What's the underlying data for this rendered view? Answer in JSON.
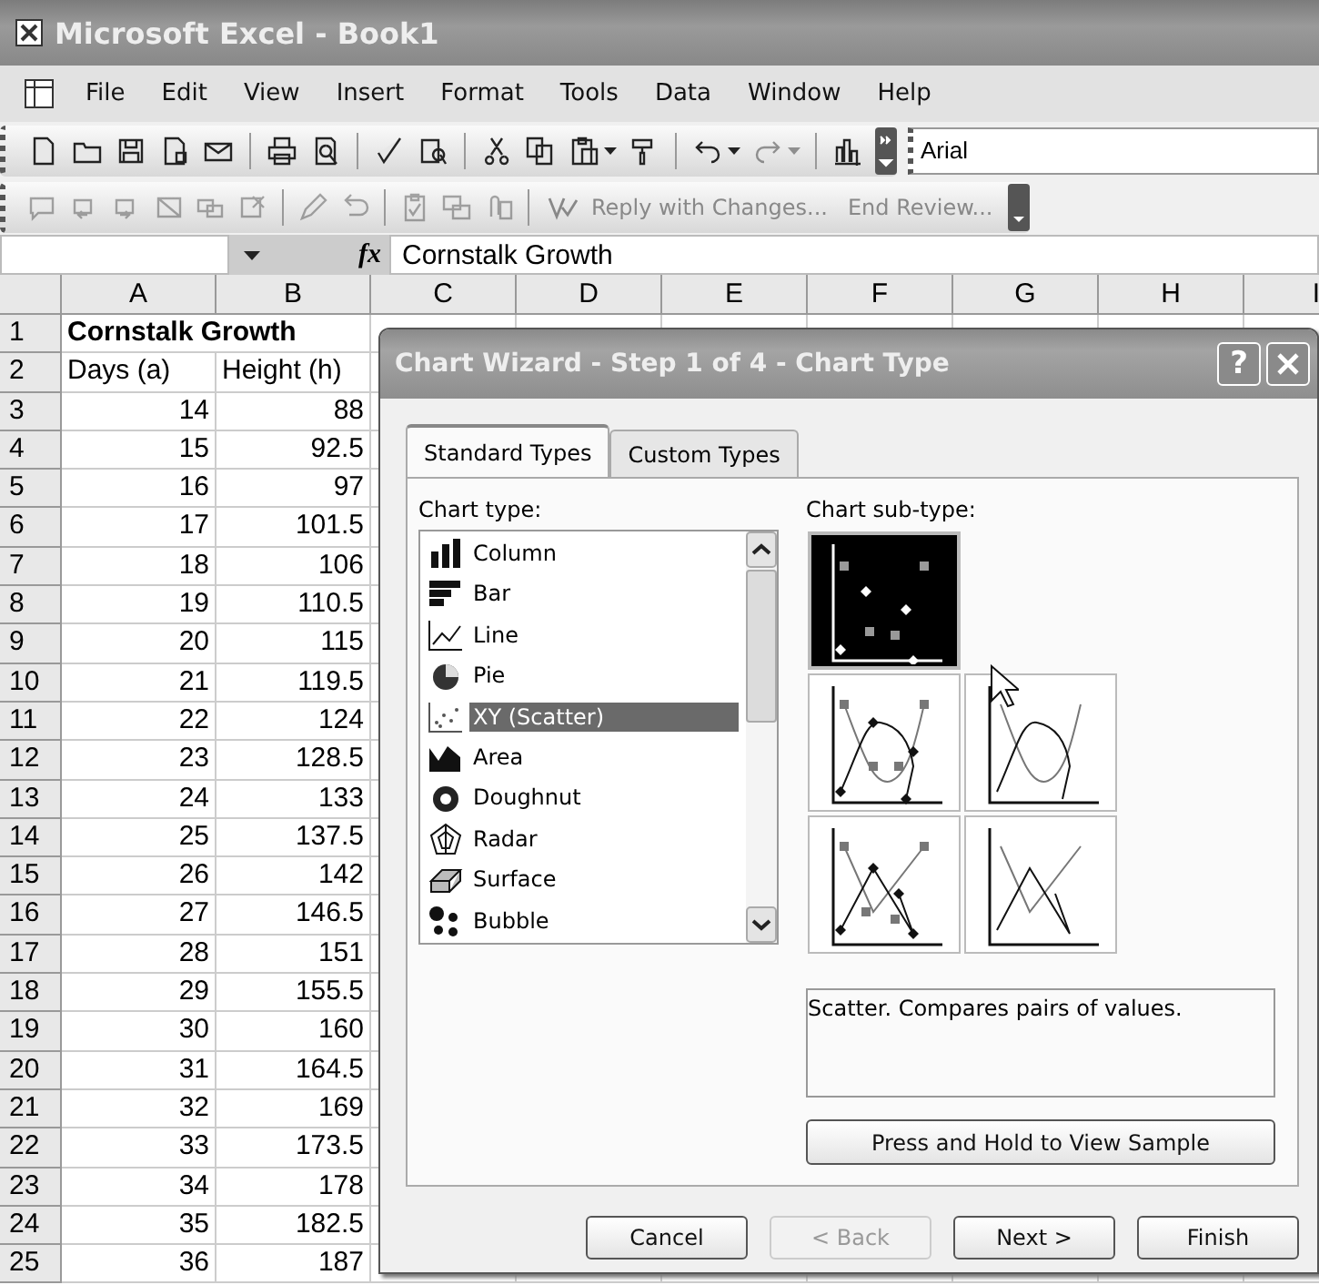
{
  "window": {
    "title": "Microsoft Excel - Book1"
  },
  "menu": [
    {
      "label": "File"
    },
    {
      "label": "Edit"
    },
    {
      "label": "View"
    },
    {
      "label": "Insert"
    },
    {
      "label": "Format"
    },
    {
      "label": "Tools"
    },
    {
      "label": "Data"
    },
    {
      "label": "Window"
    },
    {
      "label": "Help"
    }
  ],
  "font_box": {
    "value": "Arial"
  },
  "reviewing_toolbar": {
    "reply_button": "Reply with Changes...",
    "end_review_button": "End Review...",
    "disabled": true
  },
  "formula_bar": {
    "function_label": "fx",
    "value": "Cornstalk Growth"
  },
  "sheet": {
    "columns": [
      "A",
      "B",
      "C",
      "D",
      "E",
      "F",
      "G",
      "H",
      "I"
    ],
    "rows": [
      {
        "number": "1",
        "kind": "title",
        "cells": [
          "Cornstalk Growth"
        ]
      },
      {
        "number": "2",
        "kind": "header",
        "cells": [
          "Days (a)",
          "Height (h)"
        ]
      },
      {
        "number": "3",
        "kind": "data",
        "cells": [
          "14",
          "88"
        ]
      },
      {
        "number": "4",
        "kind": "data",
        "cells": [
          "15",
          "92.5"
        ]
      },
      {
        "number": "5",
        "kind": "data",
        "cells": [
          "16",
          "97"
        ]
      },
      {
        "number": "6",
        "kind": "data",
        "cells": [
          "17",
          "101.5"
        ]
      },
      {
        "number": "7",
        "kind": "data",
        "cells": [
          "18",
          "106"
        ]
      },
      {
        "number": "8",
        "kind": "data",
        "cells": [
          "19",
          "110.5"
        ]
      },
      {
        "number": "9",
        "kind": "data",
        "cells": [
          "20",
          "115"
        ]
      },
      {
        "number": "10",
        "kind": "data",
        "cells": [
          "21",
          "119.5"
        ]
      },
      {
        "number": "11",
        "kind": "data",
        "cells": [
          "22",
          "124"
        ]
      },
      {
        "number": "12",
        "kind": "data",
        "cells": [
          "23",
          "128.5"
        ]
      },
      {
        "number": "13",
        "kind": "data",
        "cells": [
          "24",
          "133"
        ]
      },
      {
        "number": "14",
        "kind": "data",
        "cells": [
          "25",
          "137.5"
        ]
      },
      {
        "number": "15",
        "kind": "data",
        "cells": [
          "26",
          "142"
        ]
      },
      {
        "number": "16",
        "kind": "data",
        "cells": [
          "27",
          "146.5"
        ]
      },
      {
        "number": "17",
        "kind": "data",
        "cells": [
          "28",
          "151"
        ]
      },
      {
        "number": "18",
        "kind": "data",
        "cells": [
          "29",
          "155.5"
        ]
      },
      {
        "number": "19",
        "kind": "data",
        "cells": [
          "30",
          "160"
        ]
      },
      {
        "number": "20",
        "kind": "data",
        "cells": [
          "31",
          "164.5"
        ]
      },
      {
        "number": "21",
        "kind": "data",
        "cells": [
          "32",
          "169"
        ]
      },
      {
        "number": "22",
        "kind": "data",
        "cells": [
          "33",
          "173.5"
        ]
      },
      {
        "number": "23",
        "kind": "data",
        "cells": [
          "34",
          "178"
        ]
      },
      {
        "number": "24",
        "kind": "data",
        "cells": [
          "35",
          "182.5"
        ]
      },
      {
        "number": "25",
        "kind": "data",
        "cells": [
          "36",
          "187"
        ]
      }
    ]
  },
  "dialog": {
    "title": "Chart Wizard - Step 1 of 4 - Chart Type",
    "help_button": "?",
    "tabs": [
      {
        "label": "Standard Types",
        "selected": true
      },
      {
        "label": "Custom Types",
        "selected": false
      }
    ],
    "chart_type_label": "Chart type:",
    "chart_types": [
      {
        "label": "Column",
        "kind": "column",
        "selected": false
      },
      {
        "label": "Bar",
        "kind": "bar",
        "selected": false
      },
      {
        "label": "Line",
        "kind": "line",
        "selected": false
      },
      {
        "label": "Pie",
        "kind": "pie",
        "selected": false
      },
      {
        "label": "XY (Scatter)",
        "kind": "scatter",
        "selected": true
      },
      {
        "label": "Area",
        "kind": "area",
        "selected": false
      },
      {
        "label": "Doughnut",
        "kind": "doughnut",
        "selected": false
      },
      {
        "label": "Radar",
        "kind": "radar",
        "selected": false
      },
      {
        "label": "Surface",
        "kind": "surface",
        "selected": false
      },
      {
        "label": "Bubble",
        "kind": "bubble",
        "selected": false
      }
    ],
    "subtype_label": "Chart sub-type:",
    "subtypes": [
      {
        "kind": "markers",
        "selected": true
      },
      {
        "kind": "smooth-markers",
        "selected": false
      },
      {
        "kind": "smooth",
        "selected": false
      },
      {
        "kind": "lines-markers",
        "selected": false
      },
      {
        "kind": "lines",
        "selected": false
      }
    ],
    "description": "Scatter. Compares pairs of values.",
    "sample_button": "Press and Hold to View Sample",
    "buttons": [
      {
        "label": "Cancel",
        "disabled": false
      },
      {
        "label": "< Back",
        "disabled": true
      },
      {
        "label": "Next >",
        "disabled": false
      },
      {
        "label": "Finish",
        "disabled": false
      }
    ]
  }
}
